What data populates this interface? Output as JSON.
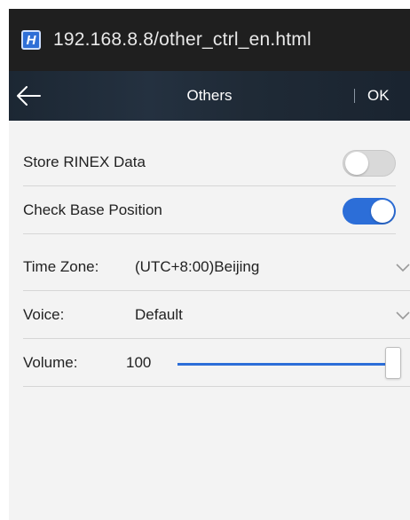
{
  "browser": {
    "favicon_letter": "H",
    "url": "192.168.8.8/other_ctrl_en.html"
  },
  "header": {
    "back_icon": "arrow-left-icon",
    "title": "Others",
    "ok_label": "OK"
  },
  "settings": {
    "store_rinex": {
      "label": "Store RINEX Data",
      "enabled": false
    },
    "check_base": {
      "label": "Check Base Position",
      "enabled": true
    },
    "time_zone": {
      "label": "Time Zone:",
      "value": "(UTC+8:00)Beijing"
    },
    "voice": {
      "label": "Voice:",
      "value": "Default"
    },
    "volume": {
      "label": "Volume:",
      "value": "100",
      "level_percent": 100
    }
  },
  "colors": {
    "accent": "#2c6ed8",
    "header_bg": "#1f2a36",
    "url_bar_bg": "#1f1f1f",
    "page_bg": "#f3f3f3"
  }
}
